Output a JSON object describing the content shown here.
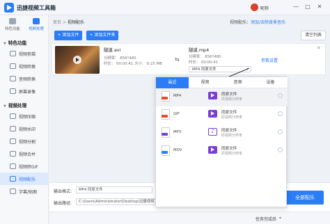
{
  "app": {
    "title": "迅捷视频工具箱",
    "user_name": "昵称"
  },
  "window_controls": {
    "min": "—",
    "max": "□",
    "close": "✕"
  },
  "rail": {
    "tabs": [
      {
        "label": "特色功能"
      },
      {
        "label": "视频处理"
      }
    ],
    "sections": [
      {
        "title": "特色功能"
      },
      {
        "title": "视频处理"
      }
    ],
    "group1": [
      {
        "label": "视频剪辑"
      },
      {
        "label": "视频转换"
      },
      {
        "label": "音频转换"
      },
      {
        "label": "屏幕录像"
      }
    ],
    "group2": [
      {
        "label": "视频压缩"
      },
      {
        "label": "视频水印"
      },
      {
        "label": "视频分割"
      },
      {
        "label": "视频合并"
      },
      {
        "label": "视频转GIF"
      },
      {
        "label": "视频配乐"
      },
      {
        "label": "字幕/贴图"
      }
    ]
  },
  "breadcrumb": {
    "home": "首页",
    "sep": ">",
    "current": "视频配乐"
  },
  "top_hint": {
    "prefix": "视频配乐：",
    "link": "添加/去除背景音乐"
  },
  "toolbar": {
    "add_file": "+ 添加文件",
    "add_folder": "+ 添加文件夹",
    "clear_list": "清空列表"
  },
  "file": {
    "src_name": "隧道.avi",
    "src_res": "分辨率：  856*480",
    "src_dur": "时长：        00:00:41",
    "src_size": "大小：      8.25 MB",
    "dst_name": "隧道.mp4",
    "dst_res": "分辨率：  856*480",
    "dst_dur": "时长：        00:00:41",
    "format_label": "MP4   同原文件",
    "settings": "参数设置",
    "close": "✕",
    "swap": "⇆"
  },
  "popup": {
    "tabs": [
      "最近",
      "视频",
      "音频",
      "设备"
    ],
    "active_tab": "最近",
    "items": [
      {
        "ext": "MP4",
        "quality": "同原文件",
        "sub": "原视频分辨率",
        "band_color": "#e44d26",
        "icon": "video-icon"
      },
      {
        "ext": "GIF",
        "quality": "同原文件",
        "sub": "原视频分辨率",
        "band_color": "#e44d26",
        "icon": "video-icon"
      },
      {
        "ext": "MP3",
        "quality": "同原文件",
        "sub": "原视频分辨率",
        "band_color": "#7a3fd6",
        "icon": "music-icon"
      },
      {
        "ext": "MOV",
        "quality": "同原文件",
        "sub": "原视频分辨率",
        "band_color": "#2a7cf7",
        "icon": "video-icon"
      }
    ]
  },
  "bottom": {
    "format_label": "输出格式:",
    "format_value": "MP4   同原文件",
    "path_label": "输出路径:",
    "path_value": "C:\\Users\\Administrator\\Desktop\\迅捷视频工具",
    "convert_all": "全部配乐",
    "task_done": "任务完成后"
  },
  "colors": {
    "accent": "#2a7cf7",
    "purple": "#7a3fd6"
  }
}
